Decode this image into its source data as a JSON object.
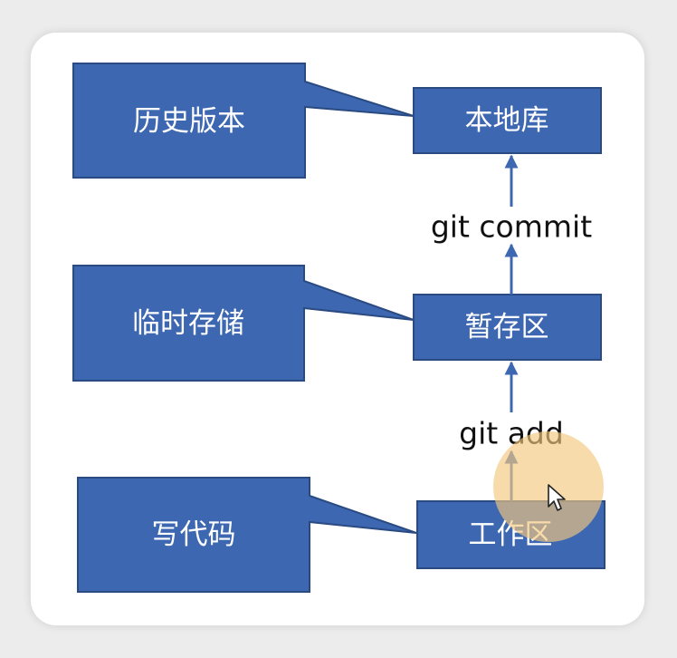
{
  "callouts": {
    "history": "历史版本",
    "temp_storage": "临时存储",
    "write_code": "写代码"
  },
  "stages": {
    "local_repo": "本地库",
    "staging": "暂存区",
    "working_dir": "工作区"
  },
  "commands": {
    "commit": "git commit",
    "add": "git add"
  },
  "colors": {
    "box_fill": "#3d68b1",
    "box_stroke": "#2a4a82",
    "arrow": "#3d68b1",
    "cursor_highlight": "#f5c77e"
  },
  "icons": {
    "cursor": "mouse-pointer-icon"
  }
}
